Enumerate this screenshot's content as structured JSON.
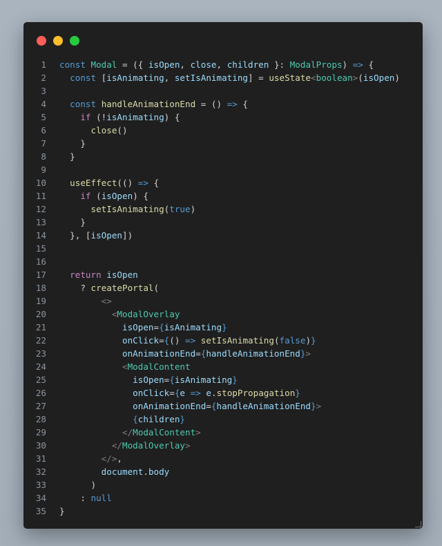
{
  "window": {
    "controls": [
      {
        "name": "close-dot",
        "color": "#ff5f56"
      },
      {
        "name": "minimize-dot",
        "color": "#ffbd2e"
      },
      {
        "name": "maximize-dot",
        "color": "#27c93f"
      }
    ]
  },
  "colors": {
    "keyword": "#569cd6",
    "control": "#c586c0",
    "variable": "#9cdcfe",
    "function": "#dcdcaa",
    "type": "#4ec9b0",
    "tag": "#4ec9b0",
    "bracket": "#808080",
    "text": "#d4d4d4"
  },
  "lines": [
    {
      "n": "1",
      "t": [
        [
          "k",
          "const "
        ],
        [
          "y",
          "Modal"
        ],
        [
          "p",
          " = ({ "
        ],
        [
          "v",
          "isOpen"
        ],
        [
          "p",
          ", "
        ],
        [
          "v",
          "close"
        ],
        [
          "p",
          ", "
        ],
        [
          "v",
          "children"
        ],
        [
          "p",
          " }: "
        ],
        [
          "c",
          "ModalProps"
        ],
        [
          "p",
          ") "
        ],
        [
          "k",
          "=>"
        ],
        [
          "p",
          " {"
        ]
      ]
    },
    {
      "n": "2",
      "t": [
        [
          "p",
          "  "
        ],
        [
          "k",
          "const"
        ],
        [
          "p",
          " ["
        ],
        [
          "v",
          "isAnimating"
        ],
        [
          "p",
          ", "
        ],
        [
          "v",
          "setIsAnimating"
        ],
        [
          "p",
          "] = "
        ],
        [
          "f",
          "useState"
        ],
        [
          "g",
          "<"
        ],
        [
          "c",
          "boolean"
        ],
        [
          "g",
          ">"
        ],
        [
          "p",
          "("
        ],
        [
          "v",
          "isOpen"
        ],
        [
          "p",
          ")"
        ]
      ]
    },
    {
      "n": "3",
      "t": []
    },
    {
      "n": "4",
      "t": [
        [
          "p",
          "  "
        ],
        [
          "k",
          "const"
        ],
        [
          "p",
          " "
        ],
        [
          "f",
          "handleAnimationEnd"
        ],
        [
          "p",
          " = () "
        ],
        [
          "k",
          "=>"
        ],
        [
          "p",
          " {"
        ]
      ]
    },
    {
      "n": "5",
      "t": [
        [
          "p",
          "    "
        ],
        [
          "m",
          "if"
        ],
        [
          "p",
          " (!"
        ],
        [
          "v",
          "isAnimating"
        ],
        [
          "p",
          ") {"
        ]
      ]
    },
    {
      "n": "6",
      "t": [
        [
          "p",
          "      "
        ],
        [
          "f",
          "close"
        ],
        [
          "p",
          "()"
        ]
      ]
    },
    {
      "n": "7",
      "t": [
        [
          "p",
          "    }"
        ]
      ]
    },
    {
      "n": "8",
      "t": [
        [
          "p",
          "  }"
        ]
      ]
    },
    {
      "n": "9",
      "t": []
    },
    {
      "n": "10",
      "t": [
        [
          "p",
          "  "
        ],
        [
          "f",
          "useEffect"
        ],
        [
          "p",
          "(() "
        ],
        [
          "k",
          "=>"
        ],
        [
          "p",
          " {"
        ]
      ]
    },
    {
      "n": "11",
      "t": [
        [
          "p",
          "    "
        ],
        [
          "m",
          "if"
        ],
        [
          "p",
          " ("
        ],
        [
          "v",
          "isOpen"
        ],
        [
          "p",
          ") {"
        ]
      ]
    },
    {
      "n": "12",
      "t": [
        [
          "p",
          "      "
        ],
        [
          "f",
          "setIsAnimating"
        ],
        [
          "p",
          "("
        ],
        [
          "k",
          "true"
        ],
        [
          "p",
          ")"
        ]
      ]
    },
    {
      "n": "13",
      "t": [
        [
          "p",
          "    }"
        ]
      ]
    },
    {
      "n": "14",
      "t": [
        [
          "p",
          "  }, ["
        ],
        [
          "v",
          "isOpen"
        ],
        [
          "p",
          "])"
        ]
      ]
    },
    {
      "n": "15",
      "t": []
    },
    {
      "n": "16",
      "t": []
    },
    {
      "n": "17",
      "t": [
        [
          "p",
          "  "
        ],
        [
          "m",
          "return"
        ],
        [
          "p",
          " "
        ],
        [
          "v",
          "isOpen"
        ]
      ]
    },
    {
      "n": "18",
      "t": [
        [
          "p",
          "    ? "
        ],
        [
          "f",
          "createPortal"
        ],
        [
          "p",
          "("
        ]
      ]
    },
    {
      "n": "19",
      "t": [
        [
          "p",
          "        "
        ],
        [
          "g",
          "<>"
        ]
      ]
    },
    {
      "n": "20",
      "t": [
        [
          "p",
          "          "
        ],
        [
          "g",
          "<"
        ],
        [
          "c",
          "ModalOverlay"
        ]
      ]
    },
    {
      "n": "21",
      "t": [
        [
          "p",
          "            "
        ],
        [
          "v",
          "isOpen"
        ],
        [
          "p",
          "="
        ],
        [
          "k",
          "{"
        ],
        [
          "v",
          "isAnimating"
        ],
        [
          "k",
          "}"
        ]
      ]
    },
    {
      "n": "22",
      "t": [
        [
          "p",
          "            "
        ],
        [
          "v",
          "onClick"
        ],
        [
          "p",
          "="
        ],
        [
          "k",
          "{"
        ],
        [
          "p",
          "() "
        ],
        [
          "k",
          "=>"
        ],
        [
          "p",
          " "
        ],
        [
          "f",
          "setIsAnimating"
        ],
        [
          "p",
          "("
        ],
        [
          "k",
          "false"
        ],
        [
          "p",
          ")"
        ],
        [
          "k",
          "}"
        ]
      ]
    },
    {
      "n": "23",
      "t": [
        [
          "p",
          "            "
        ],
        [
          "v",
          "onAnimationEnd"
        ],
        [
          "p",
          "="
        ],
        [
          "k",
          "{"
        ],
        [
          "v",
          "handleAnimationEnd"
        ],
        [
          "k",
          "}"
        ],
        [
          "g",
          ">"
        ]
      ]
    },
    {
      "n": "24",
      "t": [
        [
          "p",
          "            "
        ],
        [
          "g",
          "<"
        ],
        [
          "c",
          "ModalContent"
        ]
      ]
    },
    {
      "n": "25",
      "t": [
        [
          "p",
          "              "
        ],
        [
          "v",
          "isOpen"
        ],
        [
          "p",
          "="
        ],
        [
          "k",
          "{"
        ],
        [
          "v",
          "isAnimating"
        ],
        [
          "k",
          "}"
        ]
      ]
    },
    {
      "n": "26",
      "t": [
        [
          "p",
          "              "
        ],
        [
          "v",
          "onClick"
        ],
        [
          "p",
          "="
        ],
        [
          "k",
          "{"
        ],
        [
          "v",
          "e"
        ],
        [
          "p",
          " "
        ],
        [
          "k",
          "=>"
        ],
        [
          "p",
          " "
        ],
        [
          "v",
          "e"
        ],
        [
          "p",
          "."
        ],
        [
          "f",
          "stopPropagation"
        ],
        [
          "k",
          "}"
        ]
      ]
    },
    {
      "n": "27",
      "t": [
        [
          "p",
          "              "
        ],
        [
          "v",
          "onAnimationEnd"
        ],
        [
          "p",
          "="
        ],
        [
          "k",
          "{"
        ],
        [
          "v",
          "handleAnimationEnd"
        ],
        [
          "k",
          "}"
        ],
        [
          "g",
          ">"
        ]
      ]
    },
    {
      "n": "28",
      "t": [
        [
          "p",
          "              "
        ],
        [
          "k",
          "{"
        ],
        [
          "v",
          "children"
        ],
        [
          "k",
          "}"
        ]
      ]
    },
    {
      "n": "29",
      "t": [
        [
          "p",
          "            "
        ],
        [
          "g",
          "</"
        ],
        [
          "c",
          "ModalContent"
        ],
        [
          "g",
          ">"
        ]
      ]
    },
    {
      "n": "30",
      "t": [
        [
          "p",
          "          "
        ],
        [
          "g",
          "</"
        ],
        [
          "c",
          "ModalOverlay"
        ],
        [
          "g",
          ">"
        ]
      ]
    },
    {
      "n": "31",
      "t": [
        [
          "p",
          "        "
        ],
        [
          "g",
          "</>"
        ],
        [
          "p",
          ","
        ]
      ]
    },
    {
      "n": "32",
      "t": [
        [
          "p",
          "        "
        ],
        [
          "v",
          "document"
        ],
        [
          "p",
          "."
        ],
        [
          "v",
          "body"
        ]
      ]
    },
    {
      "n": "33",
      "t": [
        [
          "p",
          "      )"
        ]
      ]
    },
    {
      "n": "34",
      "t": [
        [
          "p",
          "    : "
        ],
        [
          "k",
          "null"
        ]
      ]
    },
    {
      "n": "35",
      "t": [
        [
          "p",
          "}"
        ]
      ]
    }
  ]
}
